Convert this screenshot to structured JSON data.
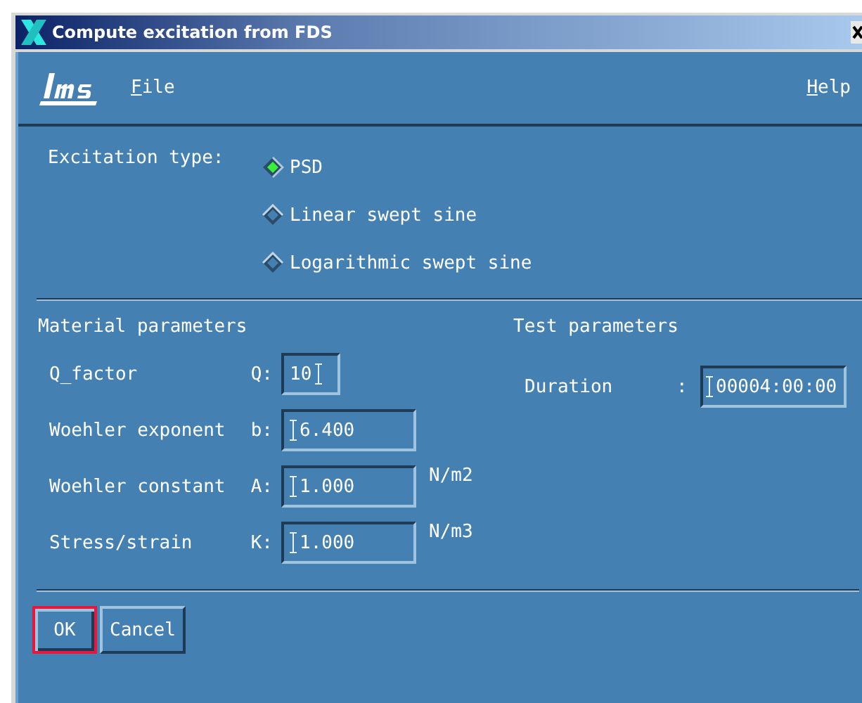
{
  "window": {
    "title": "Compute excitation from FDS"
  },
  "menu": [
    {
      "label": "File"
    },
    {
      "label": "Help"
    }
  ],
  "excitation": {
    "label": "Excitation type:",
    "options": [
      {
        "label": "PSD",
        "selected": true
      },
      {
        "label": "Linear swept sine",
        "selected": false
      },
      {
        "label": "Logarithmic swept sine",
        "selected": false
      }
    ]
  },
  "material": {
    "title": "Material parameters",
    "fields": [
      {
        "label": "Q_factor",
        "symbol": "Q:",
        "value": "10",
        "kind": "short"
      },
      {
        "label": "Woehler exponent",
        "symbol": "b:",
        "value": "6.400",
        "kind": "long"
      },
      {
        "label": "Woehler constant",
        "symbol": "A:",
        "value": "1.000",
        "kind": "long",
        "unit": "N/m2"
      },
      {
        "label": "Stress/strain",
        "symbol": "K:",
        "value": "1.000",
        "kind": "long",
        "unit": "N/m3"
      }
    ]
  },
  "test": {
    "title": "Test parameters",
    "fields": [
      {
        "label": "Duration",
        "symbol": ":",
        "value": "00004:00:00"
      }
    ]
  },
  "buttons": [
    {
      "label": "OK",
      "focused": true
    },
    {
      "label": "Cancel",
      "focused": false
    }
  ]
}
